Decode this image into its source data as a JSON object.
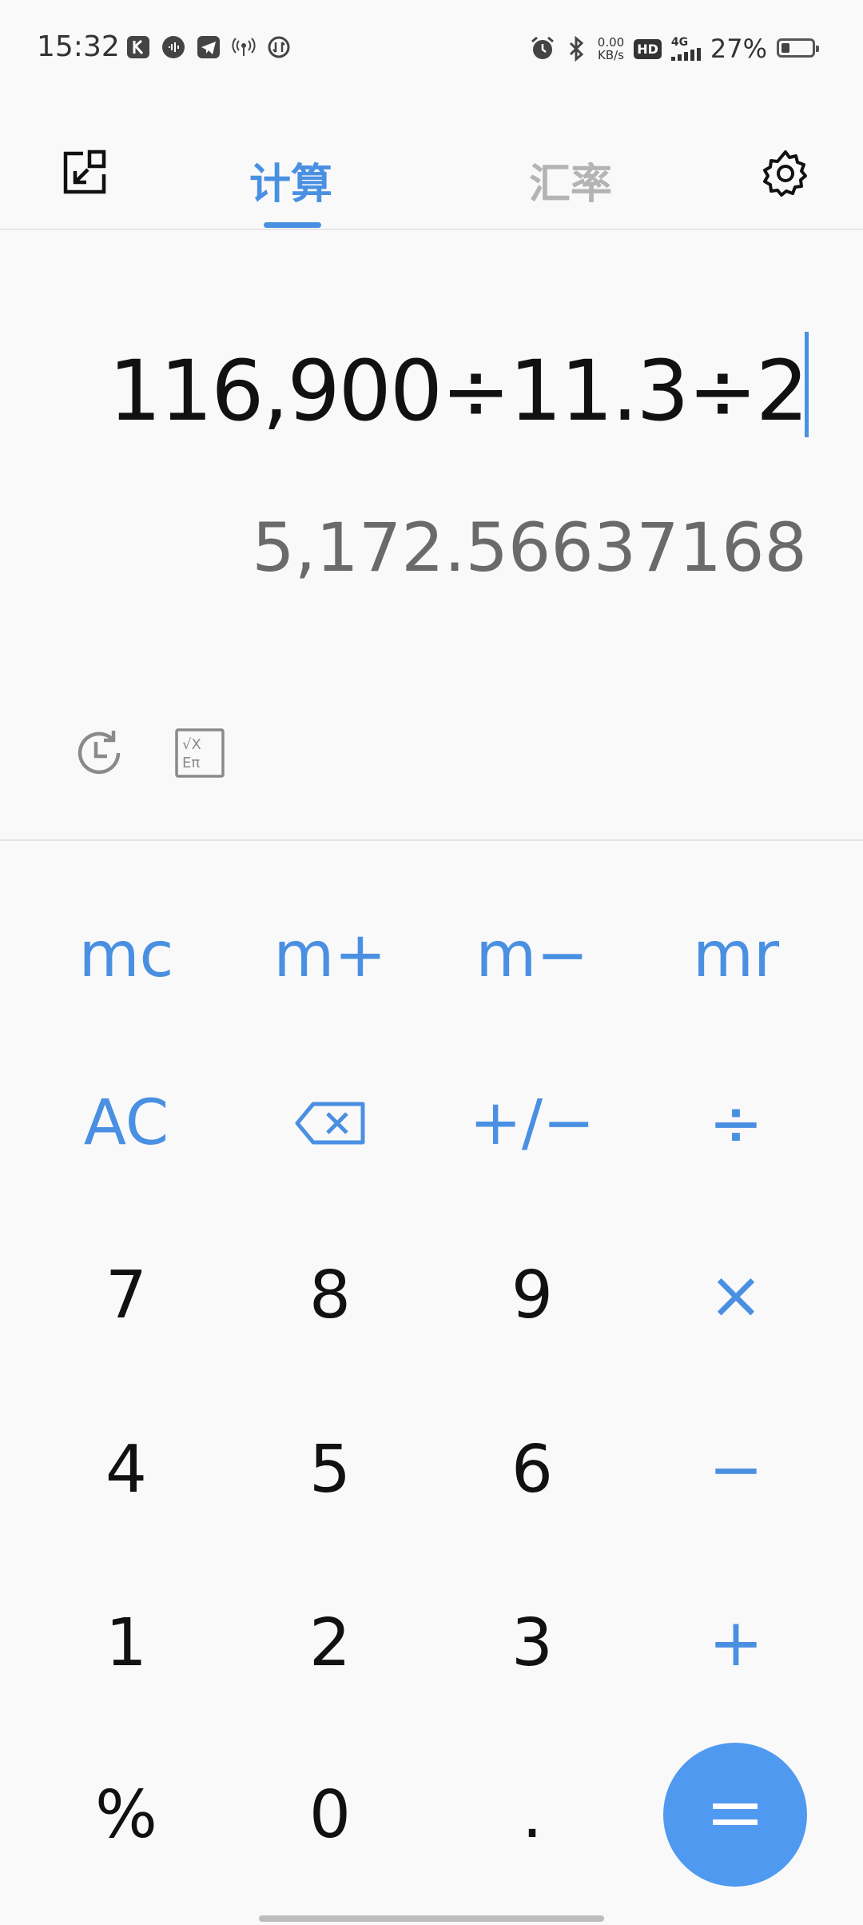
{
  "status_bar": {
    "time": "15:32",
    "net_speed_value": "0.00",
    "net_speed_unit": "KB/s",
    "hd_label": "HD",
    "network_type": "4G",
    "battery_percent": "27%",
    "battery_level": 0.27,
    "left_icons": [
      "k-app-icon",
      "podcast-icon",
      "telegram-icon",
      "hotspot-icon",
      "data-saver-icon"
    ],
    "right_icons": [
      "alarm-icon",
      "bluetooth-icon"
    ]
  },
  "nav": {
    "tabs": [
      {
        "label": "计算",
        "active": true
      },
      {
        "label": "汇率",
        "active": false
      }
    ],
    "left_icon": "floating-window-icon",
    "right_icon": "settings-gear-icon"
  },
  "display": {
    "expression": "116,900÷11.3÷2",
    "result": "5,172.56637168"
  },
  "tools": {
    "history_icon": "history-clock-icon",
    "scientific_icon": "scientific-mode-icon"
  },
  "keypad": {
    "memory": [
      "mc",
      "m+",
      "m−",
      "mr"
    ],
    "row_func": {
      "ac": "AC",
      "backspace": "backspace-icon",
      "sign": "+/−",
      "divide": "÷"
    },
    "row1": [
      "7",
      "8",
      "9"
    ],
    "row2": [
      "4",
      "5",
      "6"
    ],
    "row3": [
      "1",
      "2",
      "3"
    ],
    "row4": [
      "%",
      "0",
      "."
    ],
    "ops": {
      "multiply": "×",
      "minus": "−",
      "plus": "+",
      "equals": "="
    }
  },
  "colors": {
    "accent": "#4a90e2",
    "equals_bg": "#4f99f0",
    "inactive_tab": "#b4b4b4",
    "result_text": "#6a6a6a"
  }
}
